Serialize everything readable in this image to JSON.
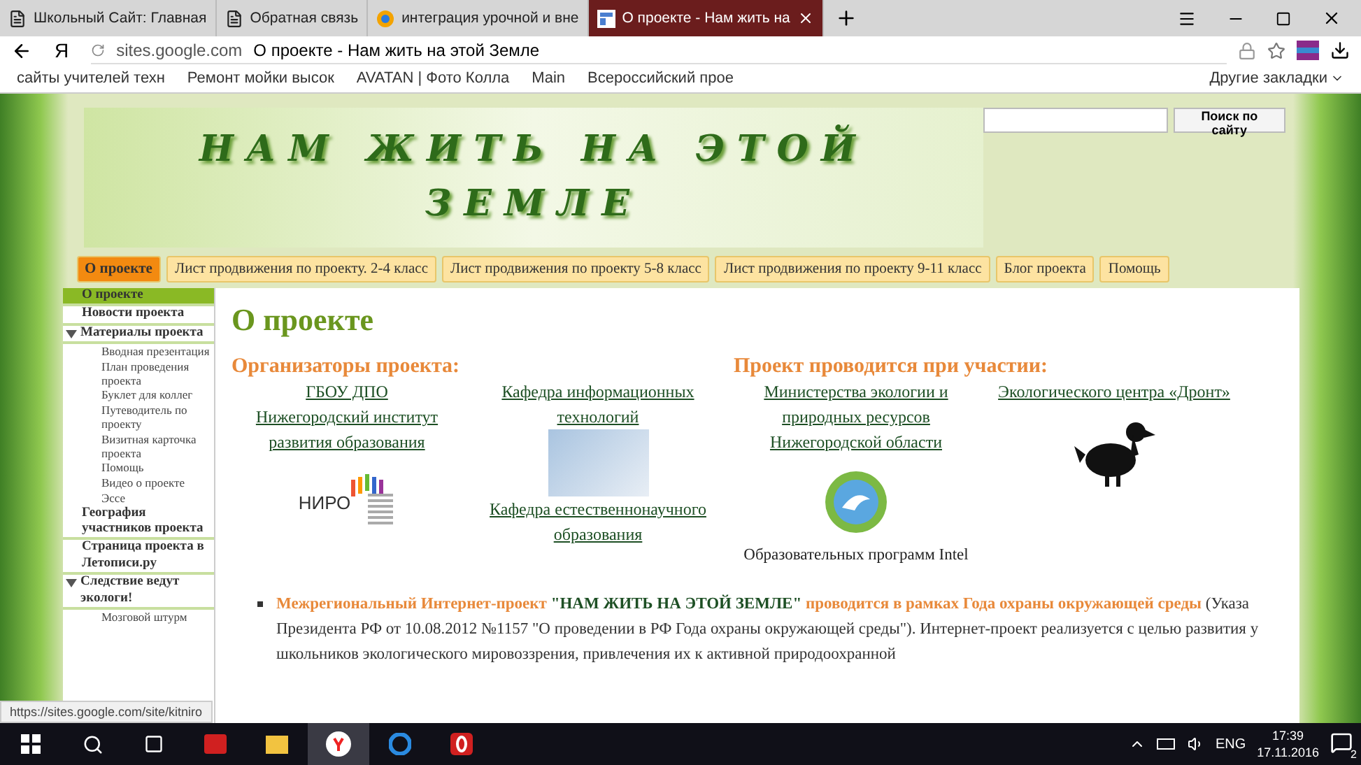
{
  "browser": {
    "tabs": [
      {
        "title": "Школьный Сайт: Главная",
        "kind": "page",
        "selected": false
      },
      {
        "title": "Обратная связь",
        "kind": "page",
        "selected": false
      },
      {
        "title": "интеграция урочной и вне",
        "kind": "web",
        "selected": false
      },
      {
        "title": "О проекте - Нам жить на",
        "kind": "site",
        "selected": true
      }
    ],
    "address": {
      "host": "sites.google.com",
      "title": "О проекте - Нам жить на этой Земле"
    },
    "yandex_button": "Я",
    "bookmarks": [
      "сайты учителей техн",
      "Ремонт мойки высок",
      "AVATAN | Фото Колла",
      "Main",
      "Всероссийский прое"
    ],
    "other_bookmarks": "Другие закладки"
  },
  "site": {
    "banner_title": "НАМ ЖИТЬ НА ЭТОЙ ЗЕМЛЕ",
    "search": {
      "button": "Поиск по сайту"
    },
    "nav": [
      {
        "label": "О проекте",
        "selected": true
      },
      {
        "label": "Лист продвижения по проекту. 2-4 класс",
        "selected": false
      },
      {
        "label": "Лист продвижения по проекту 5-8 класс",
        "selected": false
      },
      {
        "label": "Лист продвижения по проекту 9-11 класс",
        "selected": false
      },
      {
        "label": "Блог проекта",
        "selected": false
      },
      {
        "label": "Помощь",
        "selected": false
      }
    ],
    "sidebar": [
      {
        "label": "О проекте",
        "selected": true
      },
      {
        "label": "Новости проекта",
        "selected": false
      },
      {
        "label": "Материалы проекта",
        "selected": false,
        "expanded": true,
        "children": [
          {
            "label": "Вводная презентация"
          },
          {
            "label": "План проведения проекта"
          },
          {
            "label": "Буклет для коллег"
          },
          {
            "label": "Путеводитель по проекту"
          },
          {
            "label": "Визитная карточка проекта"
          },
          {
            "label": "Помощь"
          },
          {
            "label": "Видео о проекте"
          },
          {
            "label": "Эссе"
          }
        ]
      },
      {
        "label": "География участников проекта",
        "selected": false
      },
      {
        "label": "Страница проекта в Летописи.ру",
        "selected": false
      },
      {
        "label": "Следствие ведут экологи!",
        "selected": false,
        "expanded": true,
        "children": [
          {
            "label": "Мозговой штурм"
          }
        ]
      }
    ],
    "page_title": "О проекте",
    "organizers_heading": "Организаторы проекта:",
    "participants_heading": "Проект проводится при участии:",
    "partners": [
      {
        "links": [
          "ГБОУ ДПО",
          "Нижегородский институт развития образования"
        ],
        "kind": "niro",
        "logo_text": "НИРО"
      },
      {
        "links": [
          "Кафедра информационных технологий"
        ],
        "kind": "kit",
        "links_after": [
          "Кафедра естественнонаучного образования"
        ]
      },
      {
        "links": [
          "Министерства экологии и природных ресурсов Нижегородской области"
        ],
        "kind": "eco",
        "caption": "Образовательных программ Intel"
      },
      {
        "links": [
          "Экологического центра «Дронт»"
        ],
        "kind": "dodo"
      }
    ],
    "intro": {
      "lead": "Межрегиональный Интернет-проект",
      "name": "\"НАМ ЖИТЬ НА ЭТОЙ ЗЕМЛЕ\"",
      "tail": "проводится в рамках Года охраны окружающей среды",
      "text": "(Указа Президента РФ от 10.08.2012 №1157 \"О проведении в РФ Года охраны окружающей среды\").  Интернет-проект реализуется с целью развития у школьников экологического мировоззрения, привлечения их к активной природоохранной"
    }
  },
  "status_url": "https://sites.google.com/site/kitniro",
  "taskbar": {
    "language": "ENG",
    "time": "17:39",
    "date": "17.11.2016",
    "notifications": "2"
  }
}
